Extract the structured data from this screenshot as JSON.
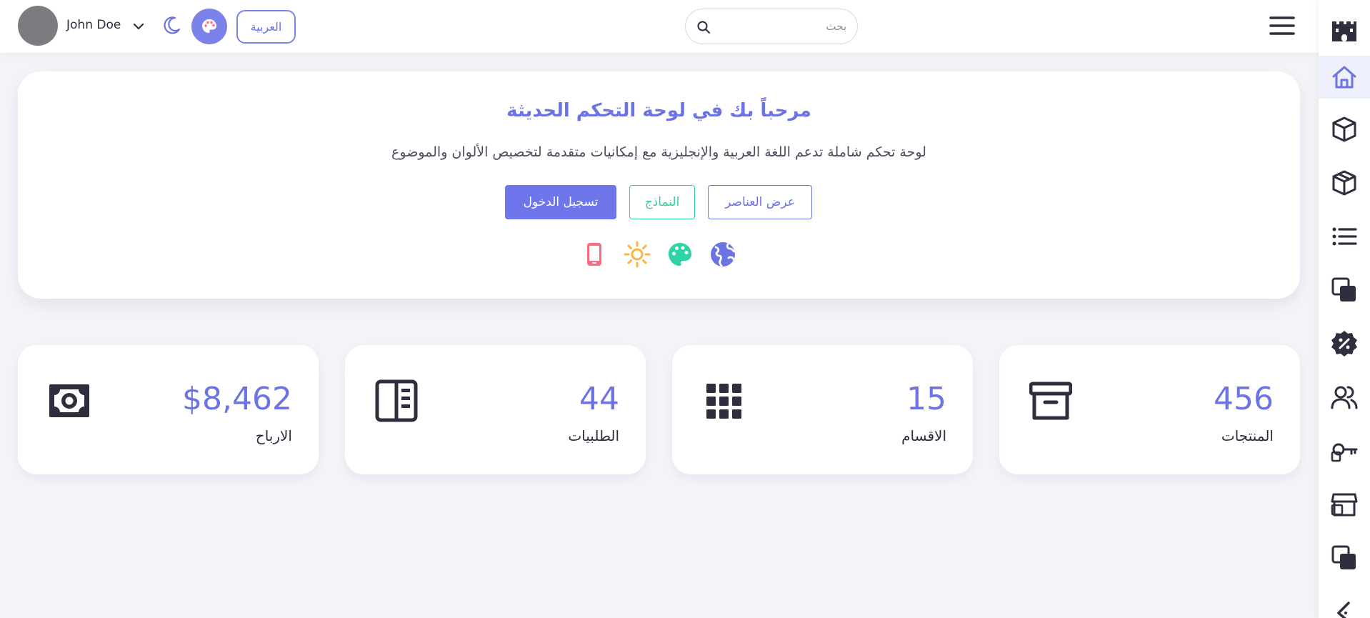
{
  "header": {
    "user_name": "John Doe",
    "language_button": "العربية",
    "search_placeholder": "بحث"
  },
  "welcome": {
    "title": "مرحباً بك في لوحة التحكم الحديثة",
    "subtitle": "لوحة تحكم شاملة تدعم اللغة العربية والإنجليزية مع إمكانيات متقدمة لتخصيص الألوان والموضوع",
    "buttons": {
      "login": "تسجيل الدخول",
      "forms": "النماذج",
      "view_elements": "عرض العناصر"
    },
    "feature_icons": [
      "globe-icon",
      "palette-icon",
      "sun-icon",
      "mobile-icon"
    ]
  },
  "stats": [
    {
      "value": "456",
      "label": "المنتجات",
      "icon": "archive-icon"
    },
    {
      "value": "15",
      "label": "الاقسام",
      "icon": "grid-icon"
    },
    {
      "value": "44",
      "label": "الطلبيات",
      "icon": "orders-icon"
    },
    {
      "value": "$8,462",
      "label": "الارباح",
      "icon": "money-icon"
    }
  ],
  "sidebar": {
    "items": [
      "home-icon",
      "cube-icon",
      "boxes-icon",
      "list-icon",
      "clone-icon",
      "discount-icon",
      "users-icon",
      "key-icon",
      "store-icon",
      "clone-icon",
      "arabic-letter-icon"
    ]
  },
  "colors": {
    "accent": "#6c73e3",
    "success": "#2fd3a6",
    "warning": "#ffb443",
    "danger": "#ff6b81",
    "dark": "#2d2f3e"
  }
}
